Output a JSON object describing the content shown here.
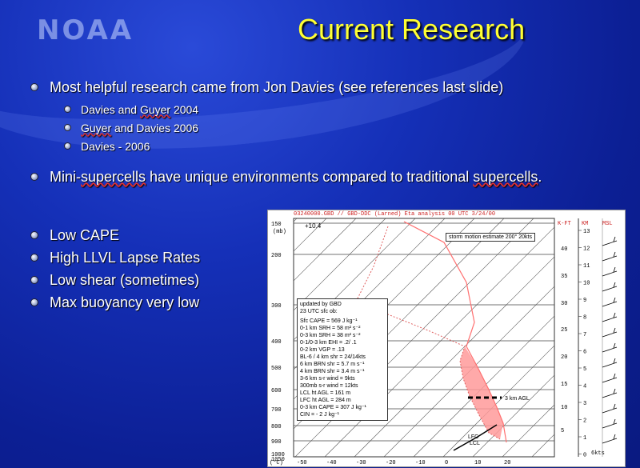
{
  "slide": {
    "logo": "NOAA",
    "title": "Current Research",
    "top_bullets": [
      {
        "text": "Most helpful research came from Jon Davies (see references last slide)",
        "level": 1
      },
      {
        "text_parts": [
          "Davies and ",
          "Guyer",
          " 2004"
        ],
        "level": 2
      },
      {
        "text_parts": [
          "Guyer",
          " and Davies 2006"
        ],
        "level": 2
      },
      {
        "text": "Davies - 2006",
        "level": 2
      }
    ],
    "mini_bullet": {
      "parts": [
        "Mini-",
        "supercells",
        " have unique environments compared to traditional ",
        "supercells",
        "."
      ]
    },
    "list_bullets": [
      "Low CAPE",
      "High LLVL Lapse Rates",
      "Low shear (sometimes)",
      "Max buoyancy very low"
    ]
  },
  "skewt": {
    "header": "03240000.GBD // GBD-DDC (Larned) Eta analysis 00 UTC 3/24/00",
    "corner_value": "+10.4",
    "mb_label": "(mb)",
    "degc_label": "(°C)",
    "storm_motion": "storm motion estimate 200° 20kts",
    "kft_label": "K-FT",
    "km_label": "KM",
    "msl_label": "MSL",
    "pressure_labels": [
      "150",
      "200",
      "300",
      "400",
      "500",
      "600",
      "700",
      "800",
      "900",
      "1000",
      "1050"
    ],
    "temp_labels": [
      "-50",
      "-40",
      "-30",
      "-20",
      "-10",
      "0",
      "10",
      "20"
    ],
    "kft_ticks": [
      "40",
      "35",
      "30",
      "25",
      "20",
      "15",
      "10",
      "5"
    ],
    "km_ticks": [
      "13",
      "12",
      "11",
      "10",
      "9",
      "8",
      "7",
      "6",
      "5",
      "4",
      "3",
      "2",
      "1",
      "0"
    ],
    "msl_value": "6kts",
    "info_lines": [
      "updated by GBD",
      "23 UTC sfc ob:",
      "Sfc CAPE = 569 J kg⁻¹",
      "0-1 km SRH = 58 m² s⁻²",
      "0-3 km SRH = 38 m² s⁻²",
      "0-1/0-3 km EHI = .2/ .1",
      "0-2 km VGP = .13",
      "BL-6 / 4 km shr = 24/14kts",
      "6 km BRN shr = 5.7 m s⁻¹",
      "4 km BRN shr = 3.4 m s⁻¹",
      "3-6 km s-r wind = 9kts",
      "300mb s-r wind = 12kts",
      "LCL ht AGL = 161 m",
      "LFC ht AGL = 284 m",
      "0-3 km CAPE = 307 J kg⁻¹",
      "CIN = - 2 J kg⁻¹"
    ],
    "agl_label": "3 km AGL",
    "lfc_label": "LFC",
    "lcl_label": "LCL"
  },
  "colors": {
    "title": "#ffff33",
    "background": "#1530b8",
    "profile": "#ff8080",
    "cape": "#ff9999"
  }
}
